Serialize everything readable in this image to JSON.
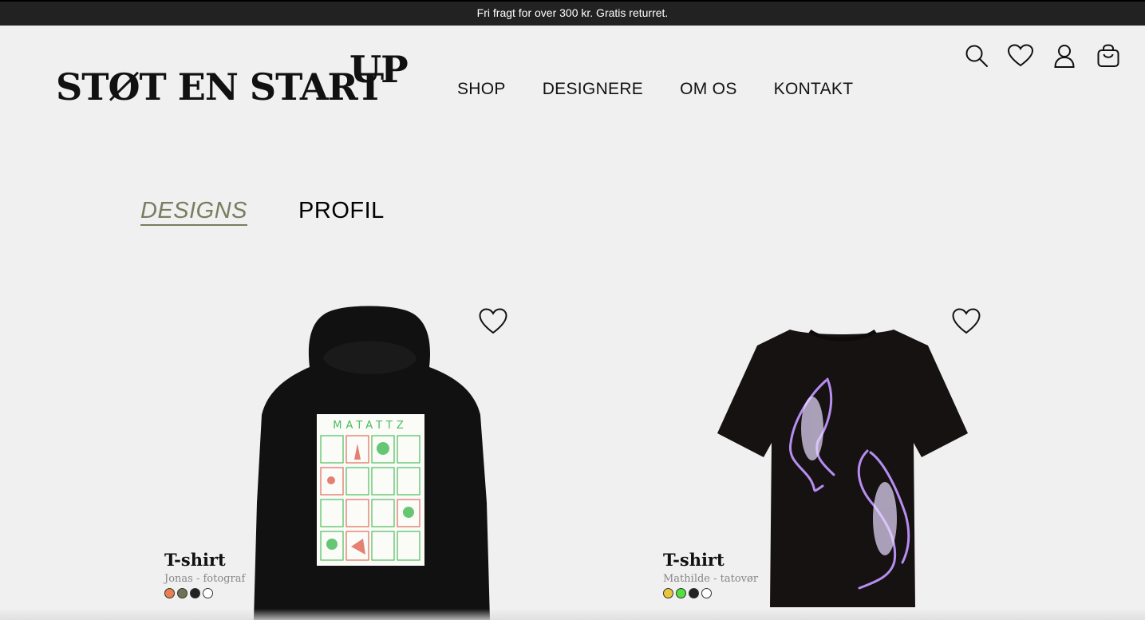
{
  "announcement": "Fri fragt for over 300 kr. Gratis returret.",
  "logo": {
    "main": "STØT EN START",
    "sup": "UP"
  },
  "nav": [
    {
      "label": "SHOP"
    },
    {
      "label": "DESIGNERE"
    },
    {
      "label": "OM OS"
    },
    {
      "label": "KONTAKT"
    }
  ],
  "header_icons": [
    "search-icon",
    "heart-icon",
    "user-icon",
    "cart-icon"
  ],
  "tabs": [
    {
      "label": "DESIGNS",
      "active": true
    },
    {
      "label": "PROFIL",
      "active": false
    }
  ],
  "accent_color": "#7a7c5f",
  "products": [
    {
      "title": "T-shirt",
      "designer": "Jonas - fotograf",
      "image": "black hoodie with green and red poster print",
      "swatches": [
        "#e8804f",
        "#6f7355",
        "#222222",
        "#ffffff"
      ]
    },
    {
      "title": "T-shirt",
      "designer": "Mathilde - tatovør",
      "image": "black t-shirt with two purple panthers",
      "swatches": [
        "#e6c83a",
        "#52e03a",
        "#222222",
        "#ffffff"
      ]
    }
  ]
}
